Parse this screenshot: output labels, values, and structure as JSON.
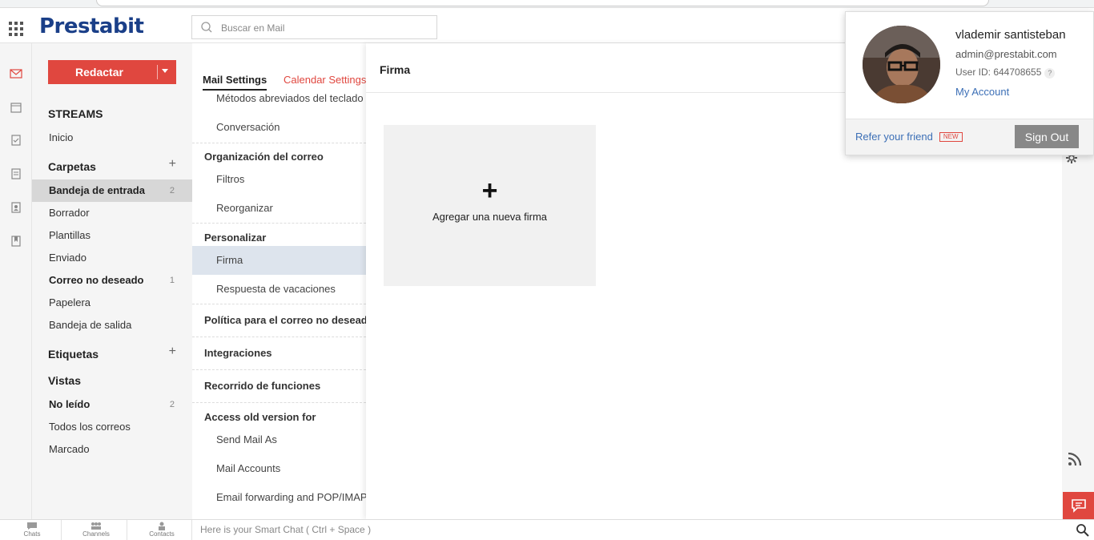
{
  "app": {
    "logo": "Prestabit"
  },
  "search": {
    "placeholder": "Buscar en Mail"
  },
  "compose": {
    "label": "Redactar"
  },
  "sidebar": {
    "streams": "STREAMS",
    "inicio": "Inicio",
    "folders_heading": "Carpetas",
    "folders": [
      {
        "label": "Bandeja de entrada",
        "count": "2"
      },
      {
        "label": "Borrador",
        "count": ""
      },
      {
        "label": "Plantillas",
        "count": ""
      },
      {
        "label": "Enviado",
        "count": ""
      },
      {
        "label": "Correo no deseado",
        "count": "1"
      },
      {
        "label": "Papelera",
        "count": ""
      },
      {
        "label": "Bandeja de salida",
        "count": ""
      }
    ],
    "tags_heading": "Etiquetas",
    "views_heading": "Vistas",
    "views": [
      {
        "label": "No leído",
        "count": "2"
      },
      {
        "label": "Todos los correos",
        "count": ""
      },
      {
        "label": "Marcado",
        "count": ""
      }
    ]
  },
  "settings": {
    "tabs": [
      "Mail Settings",
      "Calendar Settings"
    ],
    "items": {
      "shortcuts": "Métodos abreviados del teclado",
      "conversation": "Conversación",
      "org_heading": "Organización del correo",
      "filters": "Filtros",
      "reorganize": "Reorganizar",
      "custom_heading": "Personalizar",
      "signature": "Firma",
      "vacation": "Respuesta de vacaciones",
      "spam_policy": "Política para el correo no deseado",
      "integrations": "Integraciones",
      "tour": "Recorrido de funciones",
      "old_version_heading": "Access old version for",
      "send_as": "Send Mail As",
      "mail_accounts": "Mail Accounts",
      "forwarding": "Email forwarding and POP/IMAP"
    }
  },
  "main": {
    "title": "Firma",
    "add_signature": "Agregar una nueva firma",
    "add_symbol": "+"
  },
  "bottom": {
    "chats": "Chats",
    "channels": "Channels",
    "contacts": "Contacts",
    "smart_chat": "Here is your Smart Chat ( Ctrl + Space )"
  },
  "profile": {
    "name": "vlademir santisteban",
    "email": "admin@prestabit.com",
    "user_id": "User ID: 644708655",
    "help": "?",
    "my_account": "My Account",
    "refer": "Refer your friend",
    "new_badge": "NEW",
    "sign_out": "Sign Out"
  },
  "colors": {
    "accent": "#e0473f",
    "brand": "#1a3f88",
    "link": "#3c6fb6"
  }
}
